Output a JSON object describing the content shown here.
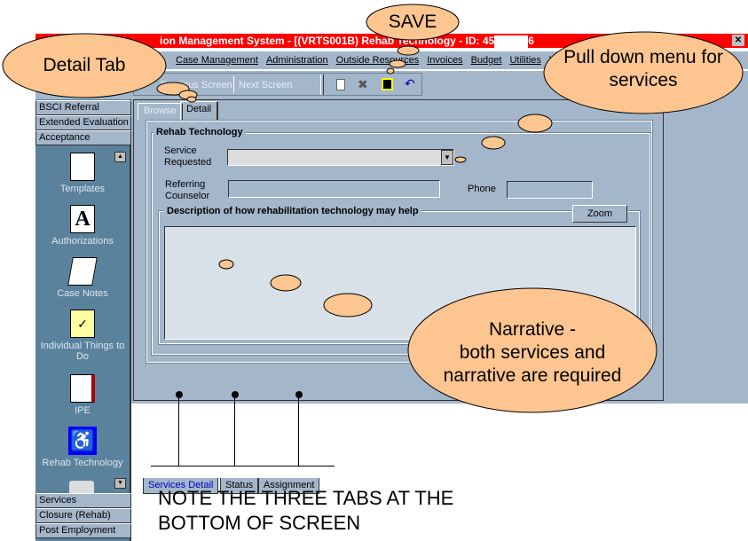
{
  "window": {
    "title": "ion Management System - [(VRTS001B) Rehab Technology -  ID: 45",
    "title_suffix": "6"
  },
  "menu": [
    "Case Management",
    "Administration",
    "Outside Resources",
    "Invoices",
    "Budget",
    "Utilities",
    "V"
  ],
  "toolbar": {
    "previous": "Previous Screen",
    "next": "Next Screen"
  },
  "sidebar": {
    "top_items": [
      "BSCI Referral",
      "Extended Evaluation",
      "Acceptance"
    ],
    "icons": [
      {
        "label": "Templates",
        "icon": "templates-icon"
      },
      {
        "label": "Authorizations",
        "icon": "authorizations-icon"
      },
      {
        "label": "Case Notes",
        "icon": "case-notes-icon"
      },
      {
        "label": "Individual Things to Do",
        "icon": "checklist-icon"
      },
      {
        "label": "IPE",
        "icon": "book-icon"
      },
      {
        "label": "Rehab Technology",
        "icon": "wheelchair-icon"
      }
    ],
    "bottom_items": [
      "Services",
      "Closure (Rehab)",
      "Post Employment"
    ]
  },
  "tabs": {
    "browse": "Browse",
    "detail": "Detail"
  },
  "form": {
    "group": "Rehab Technology",
    "service_label_1": "Service",
    "service_label_2": "Requested",
    "service_value": "",
    "counselor_label_1": "Referring",
    "counselor_label_2": "Counselor",
    "counselor_value": "",
    "phone_label": "Phone",
    "phone_value": "",
    "desc_label": "Description of how rehabilitation technology may help",
    "zoom": "Zoom",
    "desc_value": ""
  },
  "bottom_tabs": [
    "Services Detail",
    "Status",
    "Assignment"
  ],
  "annotations": {
    "save": "SAVE",
    "detail_tab": "Detail Tab",
    "pulldown": "Pull down menu for services",
    "narrative_1": "Narrative -",
    "narrative_2": "both services and",
    "narrative_3": "narrative are required",
    "note_1": "NOTE THE THREE TABS AT THE",
    "note_2": "BOTTOM OF SCREEN"
  },
  "colors": {
    "titlebar": "#ff0000",
    "panel": "#a4b6ca",
    "sidebar": "#5a829c",
    "cloud": "#fdc590",
    "active_tab_text": "#0000c0"
  }
}
